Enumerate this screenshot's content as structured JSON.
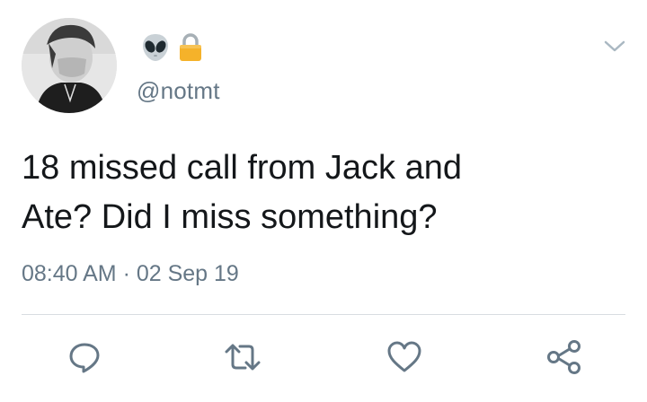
{
  "user": {
    "handle": "@notmt",
    "name_emojis": [
      "alien-emoji",
      "lock-icon"
    ]
  },
  "tweet": {
    "text": "18 missed call from Jack and\nAte? Did I miss something?",
    "timestamp": "08:40 AM · 02 Sep 19"
  },
  "actions": [
    "reply-icon",
    "retweet-icon",
    "like-icon",
    "share-icon"
  ],
  "colors": {
    "text": "#14171a",
    "secondary": "#657786",
    "icon": "#657786",
    "divider": "#d8dde1",
    "lock": "#f5b22a"
  }
}
